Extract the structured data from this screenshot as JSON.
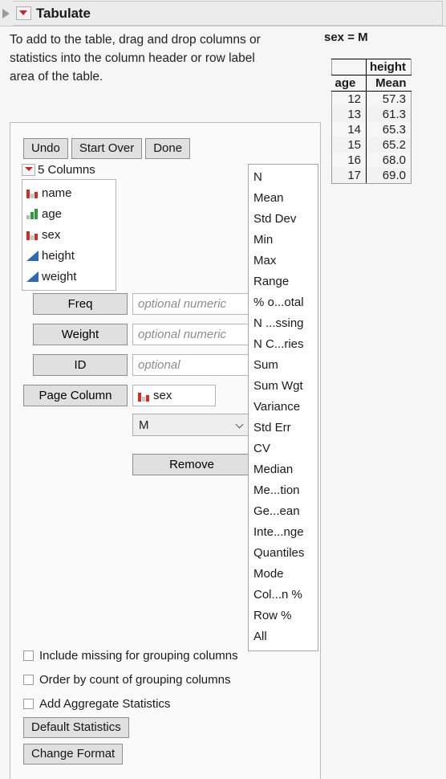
{
  "window": {
    "title": "Tabulate",
    "disclosure_icon": "disclosure-triangle-icon",
    "menu_icon": "red-triangle-menu-icon"
  },
  "instructions": {
    "text": "To add to the table, drag and drop columns or statistics into the column header or row label area of the table."
  },
  "result": {
    "page_label": "sex = M",
    "table": {
      "col_group_header": "height",
      "blank_header": "",
      "row_header": "age",
      "stat_header": "Mean",
      "rows": [
        {
          "age": "12",
          "mean": "57.3"
        },
        {
          "age": "13",
          "mean": "61.3"
        },
        {
          "age": "14",
          "mean": "65.3"
        },
        {
          "age": "15",
          "mean": "65.2"
        },
        {
          "age": "16",
          "mean": "68.0"
        },
        {
          "age": "17",
          "mean": "69.0"
        }
      ]
    }
  },
  "toolbar": {
    "undo_label": "Undo",
    "start_over_label": "Start Over",
    "done_label": "Done"
  },
  "columns_panel": {
    "header_label": "5 Columns",
    "items": [
      {
        "label": "name",
        "type": "nominal",
        "icon": "nominal-bars-icon"
      },
      {
        "label": "age",
        "type": "ordinal",
        "icon": "ordinal-bars-icon"
      },
      {
        "label": "sex",
        "type": "nominal",
        "icon": "nominal-bars-icon"
      },
      {
        "label": "height",
        "type": "continuous",
        "icon": "continuous-ramp-icon"
      },
      {
        "label": "weight",
        "type": "continuous",
        "icon": "continuous-ramp-icon"
      }
    ]
  },
  "roles": {
    "freq": {
      "label": "Freq",
      "value": "",
      "placeholder": "optional numeric"
    },
    "weight": {
      "label": "Weight",
      "value": "",
      "placeholder": "optional numeric"
    },
    "id": {
      "label": "ID",
      "value": "",
      "placeholder": "optional"
    },
    "page_column": {
      "label": "Page Column",
      "value": "sex",
      "value_icon": "nominal-bars-icon"
    },
    "level_select": {
      "value": "M",
      "chevron_icon": "chevron-down-icon"
    },
    "remove_label": "Remove"
  },
  "statistics": {
    "items": [
      "N",
      "Mean",
      "Std Dev",
      "Min",
      "Max",
      "Range",
      "% o...otal",
      "N ...ssing",
      "N C...ries",
      "Sum",
      "Sum Wgt",
      "Variance",
      "Std Err",
      "CV",
      "Median",
      "Me...tion",
      "Ge...ean",
      "Inte...nge",
      "Quantiles",
      "Mode",
      "Col...n %",
      "Row %",
      "All"
    ]
  },
  "options": {
    "checkboxes": [
      {
        "label": "Include missing for grouping columns",
        "checked": false
      },
      {
        "label": "Order by count of grouping columns",
        "checked": false
      },
      {
        "label": "Add Aggregate Statistics",
        "checked": false
      }
    ],
    "default_statistics_label": "Default Statistics",
    "change_format_label": "Change Format"
  },
  "colors": {
    "nominal_red": "#d82b1e",
    "ordinal_green": "#2e9b3e",
    "continuous_blue": "#2f68b5",
    "menu_red": "#d21f1f",
    "panel_bg": "#fafafa",
    "titlebar_bg": "#ececec"
  }
}
